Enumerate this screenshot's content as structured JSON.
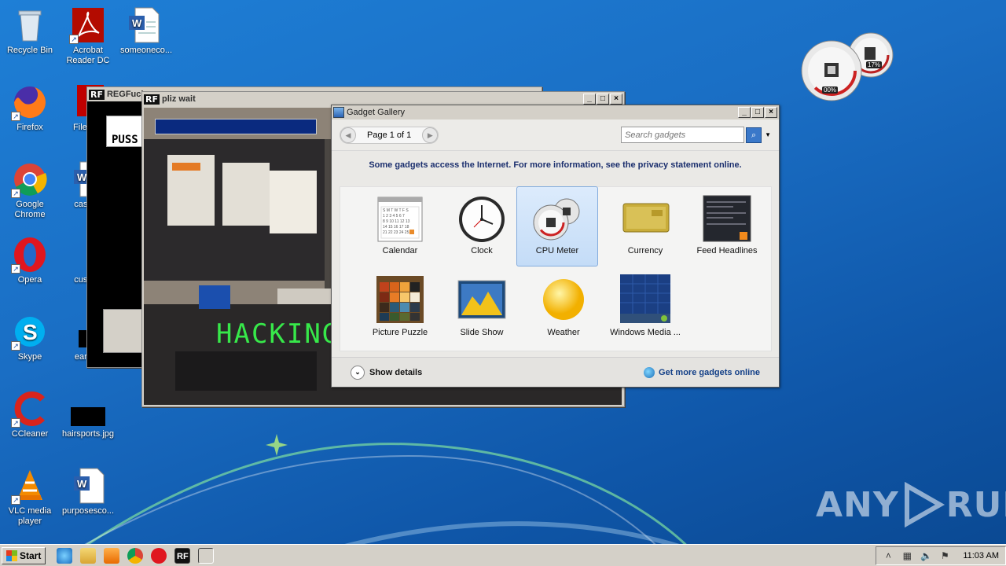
{
  "desktop": {
    "icons": [
      {
        "label": "Recycle Bin"
      },
      {
        "label": "Acrobat Reader DC"
      },
      {
        "label": "someoneco..."
      },
      {
        "label": "Firefox"
      },
      {
        "label": "FileZilla"
      },
      {
        "label": "Google Chrome"
      },
      {
        "label": "caseab"
      },
      {
        "label": "Opera"
      },
      {
        "label": "custom"
      },
      {
        "label": "Skype"
      },
      {
        "label": "earthm"
      },
      {
        "label": "CCleaner"
      },
      {
        "label": "hairsports.jpg"
      },
      {
        "label": "VLC media player"
      },
      {
        "label": "purposesco..."
      }
    ]
  },
  "cpu_gadget": {
    "cpu": "00%",
    "mem": "17%"
  },
  "windows": {
    "regfuck": {
      "title": "REGFuck",
      "body_text": "PUSS"
    },
    "pliz_wait": {
      "title": "pliz wait",
      "overlay_text": "HACKING"
    },
    "gadget_gallery": {
      "title": "Gadget Gallery",
      "page_label": "Page 1 of 1",
      "search_placeholder": "Search gadgets",
      "notice": "Some gadgets access the Internet.  For more information, see the privacy statement online.",
      "gadgets": [
        {
          "label": "Calendar"
        },
        {
          "label": "Clock"
        },
        {
          "label": "CPU Meter"
        },
        {
          "label": "Currency"
        },
        {
          "label": "Feed Headlines"
        },
        {
          "label": "Picture Puzzle"
        },
        {
          "label": "Slide Show"
        },
        {
          "label": "Weather"
        },
        {
          "label": "Windows Media ..."
        }
      ],
      "details_label": "Show details",
      "more_label": "Get more gadgets online"
    }
  },
  "taskbar": {
    "start_label": "Start",
    "clock": "11:03 AM"
  },
  "watermark": {
    "text_left": "ANY",
    "text_right": "RUN"
  }
}
